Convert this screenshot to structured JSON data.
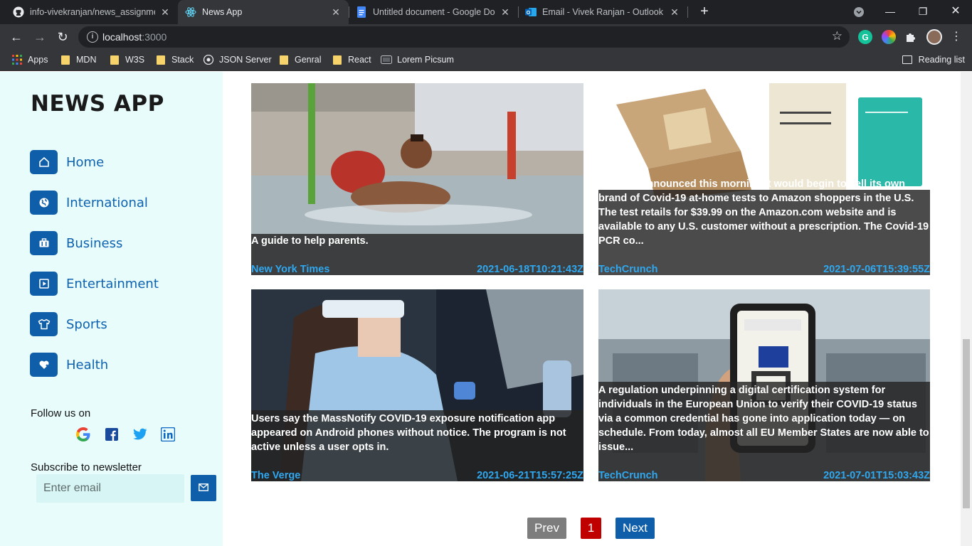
{
  "browser": {
    "tabs": [
      {
        "title": "info-vivekranjan/news_assignment",
        "icon": "github-icon",
        "active": false
      },
      {
        "title": "News App",
        "icon": "react-icon",
        "active": true
      },
      {
        "title": "Untitled document - Google Docs",
        "icon": "google-docs-icon",
        "active": false
      },
      {
        "title": "Email - Vivek Ranjan - Outlook",
        "icon": "outlook-icon",
        "active": false
      }
    ],
    "url_host": "localhost",
    "url_port": ":3000",
    "bookmarks": [
      {
        "label": "Apps",
        "icon": "apps-grid-icon"
      },
      {
        "label": "MDN",
        "icon": "folder-icon"
      },
      {
        "label": "W3S",
        "icon": "folder-icon"
      },
      {
        "label": "Stack",
        "icon": "folder-icon"
      },
      {
        "label": "JSON Server",
        "icon": "github-icon"
      },
      {
        "label": "Genral",
        "icon": "folder-icon"
      },
      {
        "label": "React",
        "icon": "folder-icon"
      },
      {
        "label": "Lorem Picsum",
        "icon": "page-icon"
      }
    ],
    "reading_list": "Reading list"
  },
  "sidebar": {
    "title": "NEWS APP",
    "nav": [
      {
        "label": "Home",
        "icon": "home-icon"
      },
      {
        "label": "International",
        "icon": "globe-icon"
      },
      {
        "label": "Business",
        "icon": "briefcase-icon"
      },
      {
        "label": "Entertainment",
        "icon": "play-icon"
      },
      {
        "label": "Sports",
        "icon": "tshirt-icon"
      },
      {
        "label": "Health",
        "icon": "heart-icon"
      }
    ],
    "follow_label": "Follow us on",
    "social": [
      "google-icon",
      "facebook-icon",
      "twitter-icon",
      "linkedin-icon"
    ],
    "newsletter_label": "Subscribe to newsletter",
    "email_placeholder": "Enter email"
  },
  "articles": [
    {
      "description": "A guide to help parents.",
      "source": "New York Times",
      "published": "2021-06-18T10:21:43Z"
    },
    {
      "description": "Amazon announced this morning it would begin to sell its own brand of Covid-19 at-home tests to Amazon shoppers in the U.S. The test retails for $39.99 on the Amazon.com website and is available to any U.S. customer without a prescription. The Covid-19 PCR co...",
      "source": "TechCrunch",
      "published": "2021-07-06T15:39:55Z"
    },
    {
      "description": "Users say the MassNotify COVID-19 exposure notification app appeared on Android phones without notice. The program is not active unless a user opts in.",
      "source": "The Verge",
      "published": "2021-06-21T15:57:25Z"
    },
    {
      "description": "A regulation underpinning a digital certification system for individuals in the European Union to verify their COVID-19 status via a common credential has gone into application today — on schedule. From today, almost all EU Member States are now able to issue...",
      "source": "TechCrunch",
      "published": "2021-07-01T15:03:43Z"
    }
  ],
  "pagination": {
    "prev": "Prev",
    "page": "1",
    "next": "Next"
  },
  "colors": {
    "primary": "#0f5ea9",
    "sidebar_bg": "#e9fcfc",
    "source_text": "#2fa8f0",
    "active_page": "#c00000",
    "prev_disabled": "#7d7d7d"
  }
}
